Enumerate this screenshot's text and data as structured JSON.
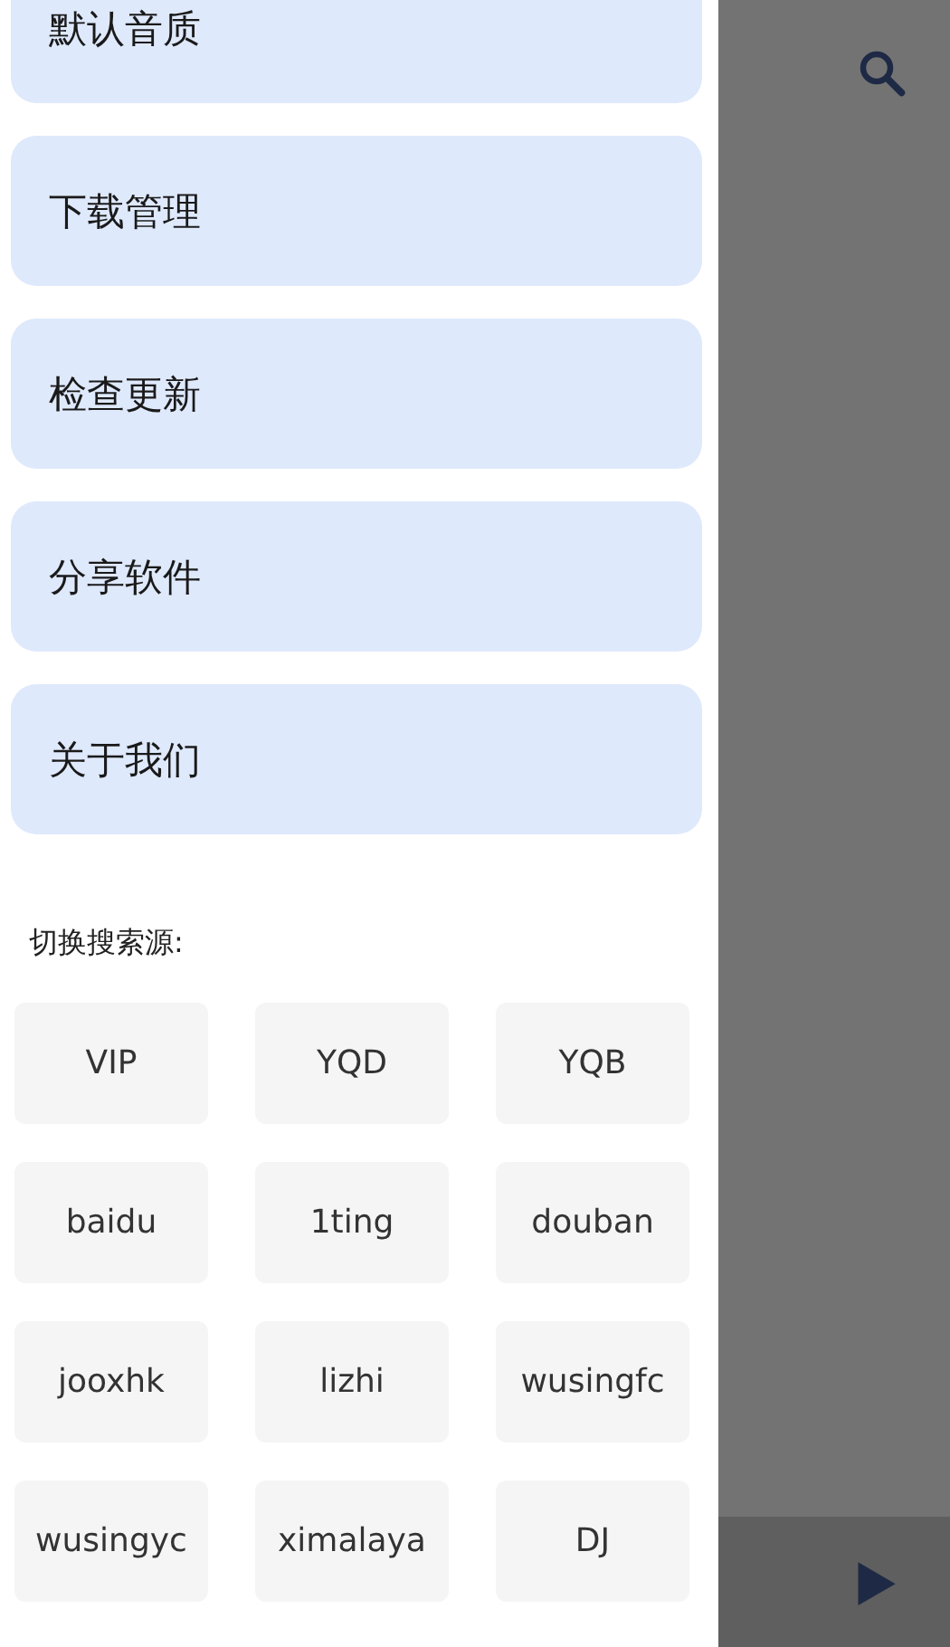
{
  "drawer": {
    "menu_items": [
      {
        "label": "默认音质"
      },
      {
        "label": "下载管理"
      },
      {
        "label": "检查更新"
      },
      {
        "label": "分享软件"
      },
      {
        "label": "关于我们"
      }
    ],
    "source_heading": "切换搜索源:",
    "sources": [
      {
        "label": "VIP"
      },
      {
        "label": "YQD"
      },
      {
        "label": "YQB"
      },
      {
        "label": "baidu"
      },
      {
        "label": "1ting"
      },
      {
        "label": "douban"
      },
      {
        "label": "jooxhk"
      },
      {
        "label": "lizhi"
      },
      {
        "label": "wusingfc"
      },
      {
        "label": "wusingyc"
      },
      {
        "label": "ximalaya"
      },
      {
        "label": "DJ"
      }
    ]
  }
}
